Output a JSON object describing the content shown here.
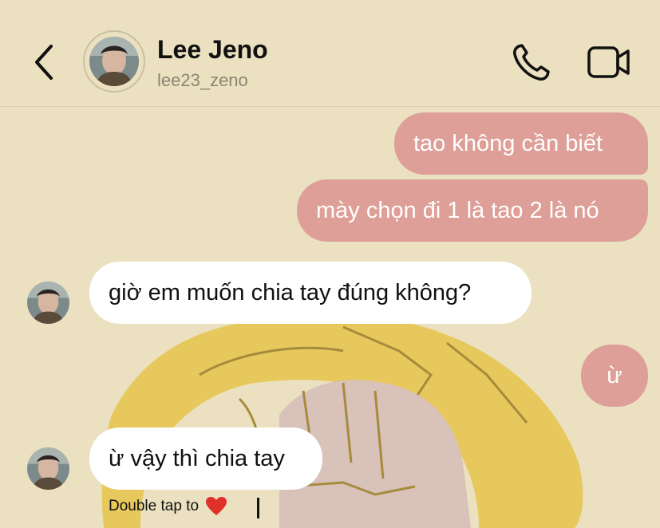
{
  "contact": {
    "name": "Lee Jeno",
    "username": "lee23_zeno"
  },
  "messages": [
    {
      "side": "out",
      "text": "tao không cần biết"
    },
    {
      "side": "out",
      "text": "mày chọn đi 1 là tao 2 là nó"
    },
    {
      "side": "in",
      "text": "giờ em muốn chia tay đúng không?"
    },
    {
      "side": "out",
      "text": "ừ"
    },
    {
      "side": "in",
      "text": "ừ vậy thì chia tay"
    }
  ],
  "hint": {
    "text": "Double tap to",
    "icon": "heart-icon"
  },
  "colors": {
    "background": "#ebe1c0",
    "outgoing_bubble": "#dd9f97",
    "incoming_bubble": "#ffffff",
    "art_yellow": "#e6c656",
    "art_pink": "#d8c2b9"
  },
  "icons": {
    "back": "chevron-left-icon",
    "call": "phone-icon",
    "video": "video-camera-icon"
  }
}
